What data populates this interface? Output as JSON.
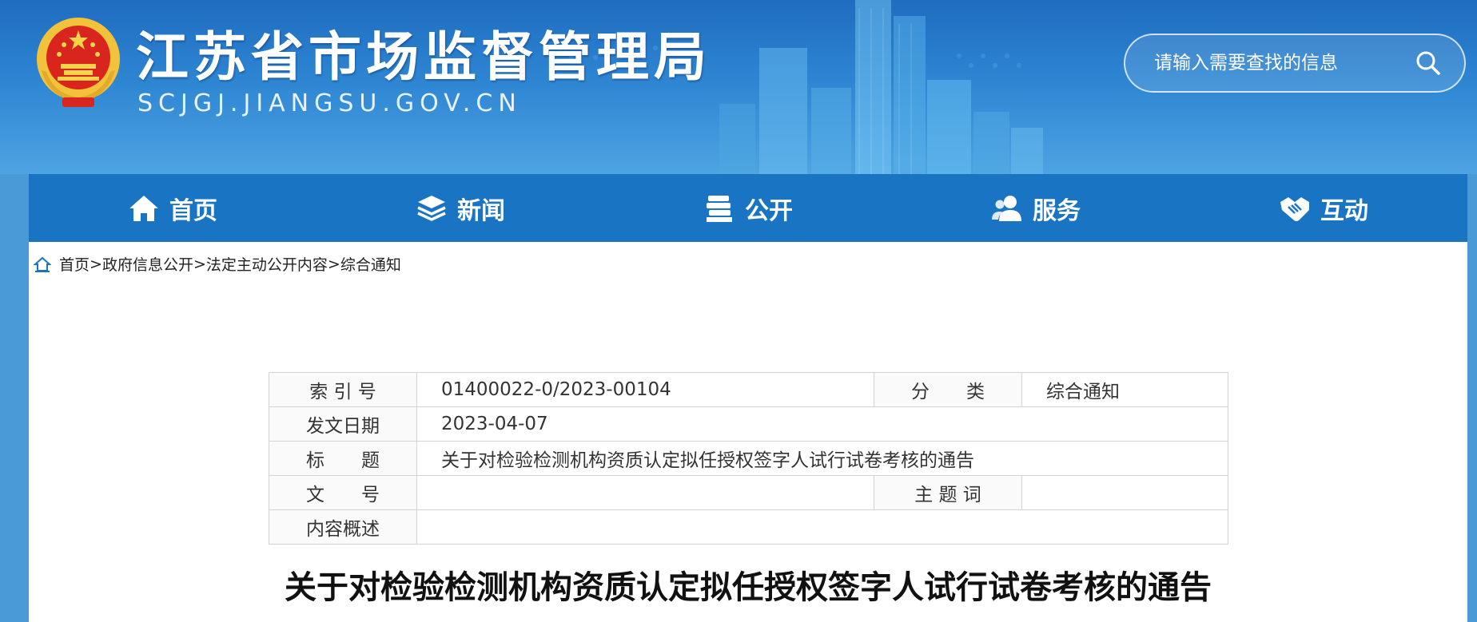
{
  "header": {
    "title": "江苏省市场监督管理局",
    "domain": "SCJGJ.JIANGSU.GOV.CN",
    "search_placeholder": "请输入需要查找的信息"
  },
  "nav": [
    {
      "label": "首页",
      "icon": "home-icon"
    },
    {
      "label": "新闻",
      "icon": "layers-icon"
    },
    {
      "label": "公开",
      "icon": "books-icon"
    },
    {
      "label": "服务",
      "icon": "users-icon"
    },
    {
      "label": "互动",
      "icon": "handshake-icon"
    }
  ],
  "breadcrumb": [
    "首页",
    "政府信息公开",
    "法定主动公开内容",
    "综合通知"
  ],
  "breadcrumb_sep": ">",
  "info_table": {
    "index_label": "索 引 号",
    "index_value": "01400022-0/2023-00104",
    "category_label": "分　　类",
    "category_value": "综合通知",
    "date_label": "发文日期",
    "date_value": "2023-04-07",
    "title_label": "标　　题",
    "title_value": "关于对检验检测机构资质认定拟任授权签字人试行试卷考核的通告",
    "docno_label": "文　　号",
    "docno_value": "",
    "keyword_label": "主 题 词",
    "keyword_value": "",
    "summary_label": "内容概述",
    "summary_value": ""
  },
  "document_title": "关于对检验检测机构资质认定拟任授权签字人试行试卷考核的通告",
  "colors": {
    "nav_bg": "#1a74c4",
    "header_top": "#1f6cc0",
    "page_bg": "#4a9ad8"
  }
}
